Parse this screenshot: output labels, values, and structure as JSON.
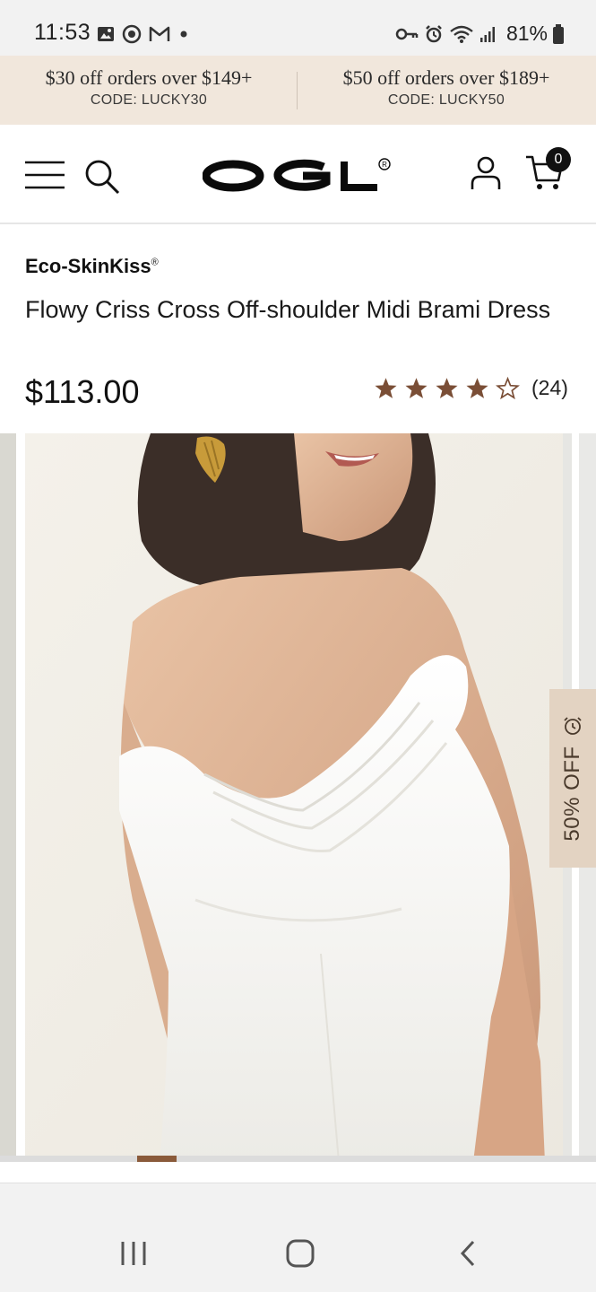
{
  "status_bar": {
    "time": "11:53",
    "battery": "81%",
    "left_icons": [
      "gallery-icon",
      "vpn-icon",
      "gmail-icon",
      "dot-icon"
    ],
    "right_icons": [
      "key-icon",
      "alarm-icon",
      "wifi-icon",
      "signal-icon",
      "battery-icon"
    ]
  },
  "promo": {
    "offers": [
      {
        "title": "$30 off orders over $149+",
        "code": "CODE: LUCKY30"
      },
      {
        "title": "$50 off orders over $189+",
        "code": "CODE: LUCKY50"
      }
    ]
  },
  "header": {
    "logo": "OGL",
    "logo_mark": "®",
    "cart_count": "0",
    "icons": [
      "menu-icon",
      "search-icon",
      "account-icon",
      "cart-icon"
    ]
  },
  "product": {
    "brand": "Eco-SkinKiss",
    "brand_mark": "®",
    "title": "Flowy Criss Cross Off-shoulder Midi Brami Dress",
    "price": "$113.00",
    "rating": 4,
    "rating_max": 5,
    "review_count": "(24)"
  },
  "gallery": {
    "discount_label": "50% OFF",
    "current_index": 3,
    "total_images": 14
  },
  "colors": {
    "promo_bg": "#f1e7dc",
    "accent_brown": "#7a4e36",
    "discount_bg": "#e3d3c2"
  },
  "nav_bar": {
    "buttons": [
      "recents-icon",
      "home-icon",
      "back-icon"
    ]
  }
}
